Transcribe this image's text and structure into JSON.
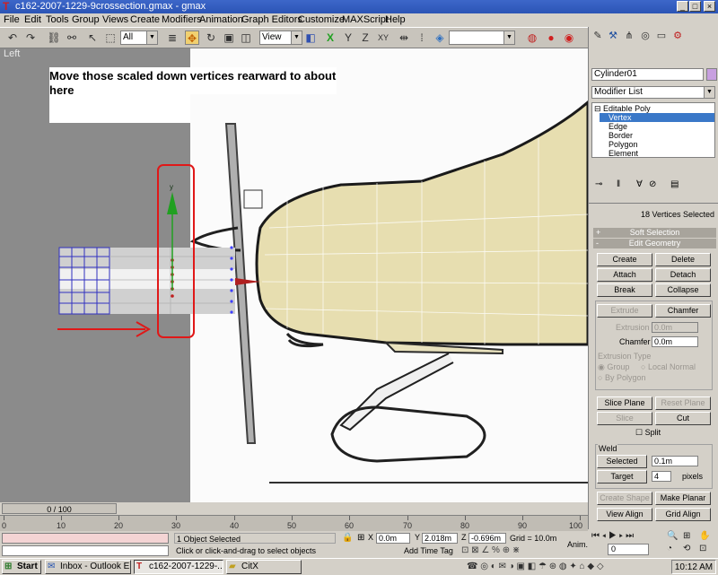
{
  "window": {
    "title": "c162-2007-1229-9crossection.gmax - gmax",
    "minimize": "_",
    "maximize": "□",
    "close": "×"
  },
  "menu": [
    "File",
    "Edit",
    "Tools",
    "Group",
    "Views",
    "Create",
    "Modifiers",
    "Animation",
    "Graph Editors",
    "Customize",
    "MAXScript",
    "Help"
  ],
  "toolbar": {
    "selection_filter": "All",
    "ref_coord": "View",
    "named_selection": ""
  },
  "viewport": {
    "label": "Left",
    "annotation": "Move those scaled down vertices rearward to about here",
    "axis_y_label": "y"
  },
  "panel": {
    "object_name": "Cylinder01",
    "modifier_list": "Modifier List",
    "stack": {
      "root": "Editable Poly",
      "items": [
        "Vertex",
        "Edge",
        "Border",
        "Polygon",
        "Element"
      ],
      "selected": "Vertex"
    },
    "selection_info": "18 Vertices Selected",
    "rollouts": {
      "soft": "Soft Selection",
      "edit": "Edit Geometry"
    },
    "buttons": {
      "create": "Create",
      "delete": "Delete",
      "attach": "Attach",
      "detach": "Detach",
      "break": "Break",
      "collapse": "Collapse",
      "extrude": "Extrude",
      "chamfer": "Chamfer",
      "slice_plane": "Slice Plane",
      "reset_plane": "Reset Plane",
      "slice": "Slice",
      "cut": "Cut",
      "weld_selected": "Selected",
      "weld_target": "Target",
      "create_shape": "Create Shape",
      "make_planar": "Make Planar",
      "view_align": "View Align",
      "grid_align": "Grid Align"
    },
    "labels": {
      "extrusion": "Extrusion",
      "extrusion_val": "0.0m",
      "chamfer": "Chamfer",
      "chamfer_val": "0.0m",
      "extrusion_type": "Extrusion Type",
      "group": "Group",
      "local_normal": "Local Normal",
      "by_polygon": "By Polygon",
      "split": "Split",
      "weld": "Weld",
      "weld_threshold": "0.1m",
      "target_pixels": "4",
      "pixels": "pixels"
    }
  },
  "timeline": {
    "slider": "0 / 100",
    "ticks": [
      "0",
      "10",
      "20",
      "30",
      "40",
      "50",
      "60",
      "70",
      "80",
      "90",
      "100"
    ]
  },
  "status": {
    "objects_selected": "1 Object Selected",
    "prompt": "Click or click-and-drag to select objects",
    "x": "0.0m",
    "y": "2.018m",
    "z": "-0.696m",
    "grid": "Grid = 10.0m",
    "add_time_tag": "Add Time Tag",
    "anim": "Anim.",
    "frame": "0"
  },
  "taskbar": {
    "start": "Start",
    "tasks": [
      "Inbox - Outlook E...",
      "c162-2007-1229-...",
      "CitX"
    ],
    "clock": "10:12 AM"
  }
}
